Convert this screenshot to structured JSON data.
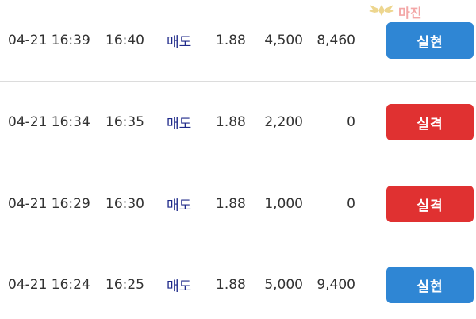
{
  "watermark": {
    "text": "마진",
    "logo_icon": "wings-logo-icon"
  },
  "rows": [
    {
      "time": "04-21 16:39",
      "close": "16:40",
      "type": "매도",
      "odds": "1.88",
      "amount": "4,500",
      "winnings": "8,460",
      "result": "실현",
      "result_color": "#2f86d4"
    },
    {
      "time": "04-21 16:34",
      "close": "16:35",
      "type": "매도",
      "odds": "1.88",
      "amount": "2,200",
      "winnings": "0",
      "result": "실격",
      "result_color": "#e03131"
    },
    {
      "time": "04-21 16:29",
      "close": "16:30",
      "type": "매도",
      "odds": "1.88",
      "amount": "1,000",
      "winnings": "0",
      "result": "실격",
      "result_color": "#e03131"
    },
    {
      "time": "04-21 16:24",
      "close": "16:25",
      "type": "매도",
      "odds": "1.88",
      "amount": "5,000",
      "winnings": "9,400",
      "result": "실현",
      "result_color": "#2f86d4"
    }
  ],
  "colors": {
    "type_text": "#1f2a8a",
    "realized": "#2f86d4",
    "disqualified": "#e03131"
  }
}
